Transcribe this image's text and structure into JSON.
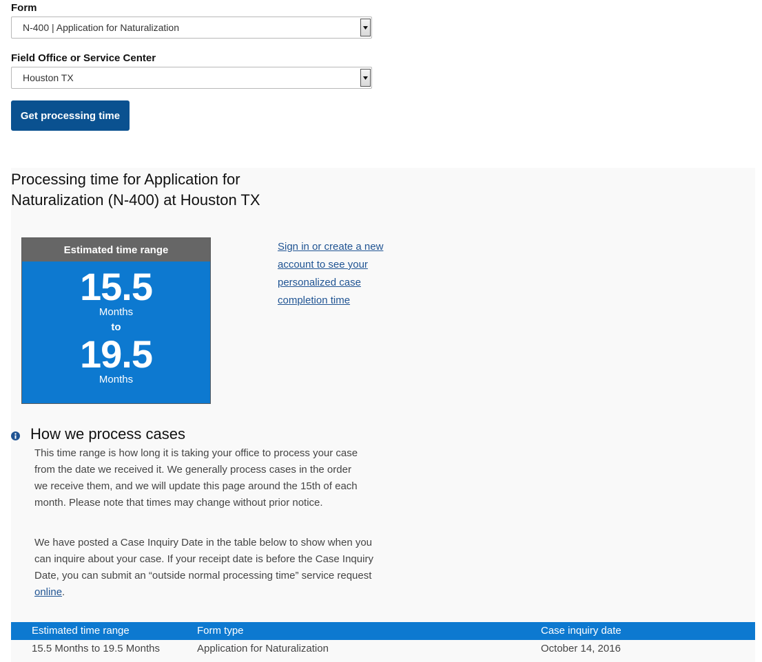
{
  "form": {
    "label": "Form",
    "selected": "N-400 | Application for Naturalization"
  },
  "office": {
    "label": "Field Office or Service Center",
    "selected": "Houston TX"
  },
  "submit_label": "Get processing time",
  "results": {
    "title": "Processing time for Application for Naturalization (N-400) at Houston TX",
    "card": {
      "header": "Estimated time range",
      "min_value": "15.5",
      "min_unit": "Months",
      "to": "to",
      "max_value": "19.5",
      "max_unit": "Months"
    },
    "signin_link": "Sign in or create a new account to see your personalized case completion time",
    "how": {
      "title": "How we process cases",
      "p1": "This time range is how long it is taking your office to process your case from the date we received it. We generally process cases in the order we receive them, and we will update this page around the 15th of each month. Please note that times may change without prior notice.",
      "p2_text": "We have posted a Case Inquiry Date in the table below to show when you can inquire about your case. If your receipt date is before the Case Inquiry Date, you can submit an “outside normal processing time” service request ",
      "p2_link": "online",
      "p2_end": "."
    },
    "table": {
      "headers": [
        "Estimated time range",
        "Form type",
        "Case inquiry date"
      ],
      "rows": [
        [
          "15.5 Months to 19.5 Months",
          "Application for Naturalization",
          "October 14, 2016"
        ]
      ]
    }
  },
  "colors": {
    "primary_button": "#0a5190",
    "card_blue": "#0d79d0",
    "card_header": "#666666",
    "link": "#205493"
  }
}
